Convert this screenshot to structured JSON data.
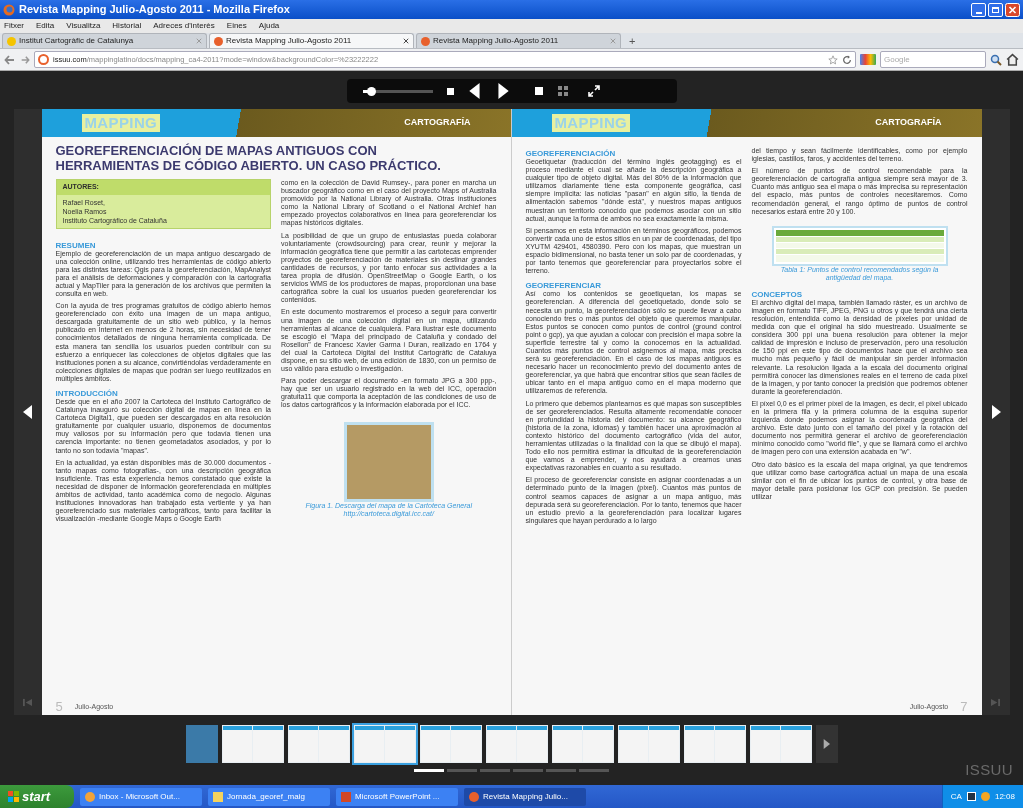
{
  "window": {
    "title": "Revista Mapping Julio-Agosto 2011 - Mozilla Firefox"
  },
  "menu": [
    "Fitxer",
    "Edita",
    "Visualitza",
    "Historial",
    "Adreces d'interès",
    "Eines",
    "Ajuda"
  ],
  "tabs": [
    {
      "label": "Institut Cartogràfic de Catalunya",
      "selected": false
    },
    {
      "label": "Revista Mapping Julio-Agosto 2011",
      "selected": true
    },
    {
      "label": "Revista Mapping Julio-Agosto 2011",
      "selected": false
    }
  ],
  "new_tab": "+",
  "address_bar": {
    "domain": "issuu.com",
    "path": "/mappinglatino/docs/mapping_ca4-2011?mode=window&backgroundColor=%23222222"
  },
  "search": {
    "placeholder": "Google"
  },
  "viewer": {
    "zoom_slider": {
      "level": 0.12
    },
    "left_page": {
      "logo": "MAPPING",
      "section": "CARTOGRAFÍA",
      "title": "GEOREFERENCIACIÓN DE MAPAS ANTIGUOS CON HERRAMIENTAS DE CÓDIGO ABIERTO. UN CASO PRÁCTICO.",
      "columns": [
        [
          {
            "kind": "authors",
            "label": "AUTORES:",
            "lines": [
              "Rafael Roset,",
              "Noelia Ramos",
              "Instituto Cartográfico de Cataluña"
            ]
          },
          {
            "kind": "heading",
            "text": "RESUMEN"
          },
          {
            "kind": "paragraph",
            "text": "Ejemplo de georeferenciación de un mapa antiguo descargado de una colección online, utilizando tres herramientas de código abierto para las distintas tareas: Qgis para la georeferenciación, MapAnalyst para el análisis de deformaciones y comparación con la cartografía actual y MapTiler para la generación de los archivos que permiten la consulta en web."
          },
          {
            "kind": "paragraph",
            "text": "Con la ayuda de tres programas gratuitos de código abierto hemos georeferenciado con éxito una imagen de un mapa antiguo, descargada gratuitamente de un sitio web público, y la hemos publicado en Internet en menos de 2 horas, sin necesidad de tener conocimientos detallados de ninguna herramienta complicada. De esta manera tan sencilla los usuarios pueden contribuir con su esfuerzo a enriquecer las colecciones de objetos digitales que las instituciones ponen a su alcance, convirtiéndolas verdaderamente en colecciones digitales de mapas que podrán ser luego reutilizados en múltiples ámbitos."
          },
          {
            "kind": "heading",
            "text": "INTRODUCCIÓN"
          },
          {
            "kind": "paragraph",
            "text": "Desde que en el año 2007 la Cartoteca del Instituto Cartográfico de Catalunya inauguró su colección digital de mapas en línea en la Cartoteca Digital1, que pueden ser descargados en alta resolución gratuitamente por cualquier usuario, disponemos de documentos muy valiosos por su información pero que todavía tienen una carencia importante: no tienen geometadatos asociados, y por lo tanto no son todavía \"mapas\"."
          },
          {
            "kind": "paragraph",
            "text": "En la actualidad, ya están disponibles más de 30.000 documentos -tanto mapas como fotografías-, con una descripción geográfica insuficiente. Tras esta experiencia hemos constatado que existe la necesidad de disponer de información georeferenciada en múltiples ámbitos de actividad, tanto académica como de negocio. Algunas instituciones innovadoras han trabajado esta vertiente y ya han georeferenciado sus materiales cartográficos, tanto para facilitar la visualización -mediante Google Maps o Google Earth"
          }
        ],
        [
          {
            "kind": "paragraph",
            "text": "como en la colección de David Rumsey-, para poner en marcha un buscador geográfico como en el caso del proyecto Maps of Australia promovido por la National Library of Australia. Otras instituciones como la National Library of Scotland o el National Archief han empezado proyectos colaborativos en línea para georeferenciar los mapas históricos digitales."
          },
          {
            "kind": "paragraph",
            "text": "La posibilidad de que un grupo de entusiastas pueda colaborar voluntariamente (crowdsourcing) para crear, reunir y mejorar la información geográfica tiene que permitir a las cartotecas emprender proyectos de georeferenciación de materiales sin destinar grandes cantidades de recursos, y por tanto enfocar sus actividades a la tarea propia de difusión. OpenStreetMap o Google Earth, o los servicios WMS de los productores de mapas, proporcionan una base cartográfica sobre la cual los usuarios pueden georeferenciar los contenidos."
          },
          {
            "kind": "paragraph",
            "text": "En este documento mostraremos el proceso a seguir para convertir una imagen de una colección digital en un mapa, utilizando herramientas al alcance de cualquiera. Para ilustrar este documento se escogió el \"Mapa del principado de Cataluña y condado del Rosellon\" de Francesc Xavier Garma i Duran, realizado en 1764 y del cual la Cartoteca Digital del Institut Cartogràfic de Cataluya dispone, en su sitio web, de una edición de 1830, con un permiso de uso válido para estudio o investigación."
          },
          {
            "kind": "paragraph",
            "text": "Para poder descargar el documento -en formato JPG a 300 ppp-, hay que ser un usuario registrado en la web del ICC, operación gratuita11 que comporta la aceptación de las condiciones de uso de los datos cartográficos y la información elaborada por el ICC."
          },
          {
            "kind": "figure",
            "caption": [
              "Figura 1. Descarga del mapa de la Cartoteca General",
              "http://cartoteca.digital.icc.cat/"
            ]
          }
        ]
      ],
      "footer": {
        "page": "5",
        "label": "Julio-Agosto"
      }
    },
    "right_page": {
      "logo": "MAPPING",
      "section": "CARTOGRAFÍA",
      "columns": [
        [
          {
            "kind": "heading",
            "text": "GEOREFERENCIACIÓN"
          },
          {
            "kind": "paragraph",
            "text": "Geoetiquetar (traducción del término inglés geotagging) es el proceso mediante el cual se añade la descripción geográfica a cualquier tipo de objeto digital. Más del 80% de la información que utilizamos diariamente tiene esta componente geográfica, casi siempre implícita: las noticias \"pasan\" en algún sitio, la tienda de alimentación sabemos \"dónde está\", y nuestros mapas antiguos muestran un territorio conocido que podemos asociar con un sitio actual, aunque la forma de ambos no sea exactamente la misma."
          },
          {
            "kind": "paragraph",
            "text": "Si pensamos en esta información en términos geográficos, podemos convertir cada uno de estos sitios en un par de coordenadas, del tipo XYUTM 429401, 4580390. Pero con los mapas, que muestran un espacio bidimensional, no basta tener un solo par de coordenadas, y por tanto tenemos que georeferenciar para proyectarlos sobre el terreno."
          },
          {
            "kind": "heading",
            "text": "GEOREFERENCIAR"
          },
          {
            "kind": "paragraph",
            "text": "Así como los contenidos se geoetiquetan, los mapas se georeferencian. A diferencia del geoetiquetado, donde solo se necesita un punto, la georeferenciación sólo se puede llevar a cabo conociendo tres o más puntos del objeto que queremos manipular. Estos puntos se conocen como puntos de control (ground control point o gcp), ya que ayudan a colocar con precisión el mapa sobre la superficie terrestre tal y como la conocemos en la actualidad. Cuantos más puntos de control asignemos al mapa, más precisa será su georeferenciación. En el caso de los mapas antiguos es necesario hacer un reconocimiento previo del documento antes de georeferenciar, ya que habrá que encontrar sitios que sean fáciles de ubicar tanto en el mapa antiguo como en el mapa moderno que utilizaremos de referencia."
          },
          {
            "kind": "paragraph",
            "text": "Lo primero que debemos plantearnos es qué mapas son susceptibles de ser georeferenciados. Resulta altamente recomendable conocer en profundidad la historia del documento: su alcance geográfico (historia de la zona, idiomas) y también hacer una aproximación al contexto histórico del documento cartográfico (vida del autor, herramientas utilizadas o la finalidad con la que se dibujó el mapa). Todo ello nos permitirá estimar la dificultad de la georeferenciación que vamos a emprender, y nos ayudará a crearnos unas expectativas razonables en cuanto a su resultado."
          },
          {
            "kind": "paragraph",
            "text": "El proceso de georeferenciar consiste en asignar coordenadas a un determinado punto de la imagen (píxel). Cuantos más puntos de control seamos capaces de asignar a un mapa antiguo, más depurada será su georeferenciación. Por lo tanto, tenemos que hacer un estudio previo a la georeferenciación para localizar lugares singulares que hayan perdurado a lo largo"
          }
        ],
        [
          {
            "kind": "paragraph",
            "text": "del tiempo y sean fácilmente identificables, como por ejemplo iglesias, castillos, faros, y accidentes del terreno."
          },
          {
            "kind": "paragraph",
            "text": "El número de puntos de control recomendable para la georeferenciación de cartografía antigua siempre será mayor de 3. Cuanto más antiguo sea el mapa o más imprecisa su representación del espacio, más puntos de controles necesitaremos. Como recomendación general, el rango óptimo de puntos de control necesarios estará entre 20 y 100."
          },
          {
            "kind": "table",
            "caption": [
              "Tabla 1: Puntos de control recomendados según la",
              "antigüedad del mapa."
            ]
          },
          {
            "kind": "heading",
            "text": "CONCEPTOS"
          },
          {
            "kind": "paragraph",
            "text": "El archivo digital del mapa, también llamado ráster, es un archivo de imagen en formato TIFF, JPEG, PNG u otros y que tendrá una cierta resolución, entendida como la densidad de píxeles por unidad de medida con que el original ha sido muestreado. Usualmente se considera 300 ppi una buena resolución para obtener la mejor calidad de impresión e incluso de preservación, pero una resolución de 150 ppi en este tipo de documentos hace que el archivo sea mucho más pequeño y fácil de manipular sin perder información relevante. La resolución ligada a la escala del documento original permitirá conocer las dimensiones reales en el terreno de cada píxel de la imagen, y por tanto conocer la precisión que podremos obtener durante la georeferenciación."
          },
          {
            "kind": "paragraph",
            "text": "El píxel 0,0 es el primer píxel de la imagen, es decir, el píxel ubicado en la primera fila y la primera columna de la esquina superior izquierda donde podemos asignar la coordenada geográfica del archivo. Este dato junto con el tamaño del píxel y la rotación del documento nos permitirá generar el archivo de georeferenciación mínimo conocido como \"world file\", y que se llamará como el archivo de imagen pero con una extensión acabada en \"w\"."
          },
          {
            "kind": "paragraph",
            "text": "Otro dato básico es la escala del mapa original, ya que tendremos que utilizar como base cartográfica actual un mapa de una escala similar con el fin de ubicar los puntos de control, y otra base de mayor detalle para posicionar los GCP con precisión. Se pueden utilizar"
          }
        ]
      ],
      "footer": {
        "page": "7",
        "label": "Julio-Agosto"
      }
    },
    "thumbnails": [
      {
        "selected": false
      },
      {
        "selected": false
      },
      {
        "selected": false
      },
      {
        "selected": true
      },
      {
        "selected": false
      },
      {
        "selected": false
      },
      {
        "selected": false
      },
      {
        "selected": false
      },
      {
        "selected": false
      },
      {
        "selected": false
      }
    ],
    "page_dots": [
      {
        "selected": true
      },
      {
        "selected": false
      },
      {
        "selected": false
      },
      {
        "selected": false
      },
      {
        "selected": false
      },
      {
        "selected": false
      }
    ],
    "logo": "ISSUU"
  },
  "taskbar": {
    "start": "start",
    "items": [
      {
        "label": "Inbox - Microsoft Out...",
        "selected": false,
        "kind": "mail"
      },
      {
        "label": "Jornada_georef_maig",
        "selected": false,
        "kind": "folder"
      },
      {
        "label": "Microsoft PowerPoint ...",
        "selected": false,
        "kind": "slides"
      },
      {
        "label": "Revista Mapping Julio...",
        "selected": true,
        "kind": "browser"
      }
    ],
    "language": "CA",
    "clock": "12:08"
  }
}
